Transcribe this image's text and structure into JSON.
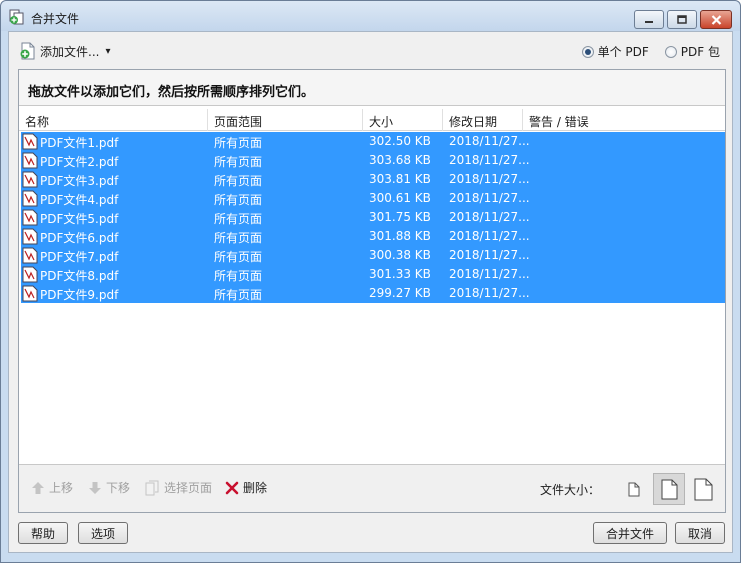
{
  "window": {
    "title": "合并文件"
  },
  "toolbar": {
    "add_files_label": "添加文件...",
    "dropdown_arrow": "▾"
  },
  "output_mode": {
    "options": [
      {
        "label": "单个 PDF",
        "selected": true
      },
      {
        "label": "PDF 包",
        "selected": false
      }
    ]
  },
  "instruction": "拖放文件以添加它们，然后按所需顺序排列它们。",
  "table": {
    "columns": [
      "名称",
      "页面范围",
      "大小",
      "修改日期",
      "警告 / 错误"
    ],
    "rows": [
      {
        "name": "PDF文件1.pdf",
        "range": "所有页面",
        "size": "302.50 KB",
        "date": "2018/11/27...",
        "warning": ""
      },
      {
        "name": "PDF文件2.pdf",
        "range": "所有页面",
        "size": "303.68 KB",
        "date": "2018/11/27...",
        "warning": ""
      },
      {
        "name": "PDF文件3.pdf",
        "range": "所有页面",
        "size": "303.81 KB",
        "date": "2018/11/27...",
        "warning": ""
      },
      {
        "name": "PDF文件4.pdf",
        "range": "所有页面",
        "size": "300.61 KB",
        "date": "2018/11/27...",
        "warning": ""
      },
      {
        "name": "PDF文件5.pdf",
        "range": "所有页面",
        "size": "301.75 KB",
        "date": "2018/11/27...",
        "warning": ""
      },
      {
        "name": "PDF文件6.pdf",
        "range": "所有页面",
        "size": "301.88 KB",
        "date": "2018/11/27...",
        "warning": ""
      },
      {
        "name": "PDF文件7.pdf",
        "range": "所有页面",
        "size": "300.38 KB",
        "date": "2018/11/27...",
        "warning": ""
      },
      {
        "name": "PDF文件8.pdf",
        "range": "所有页面",
        "size": "301.33 KB",
        "date": "2018/11/27...",
        "warning": ""
      },
      {
        "name": "PDF文件9.pdf",
        "range": "所有页面",
        "size": "299.27 KB",
        "date": "2018/11/27...",
        "warning": ""
      }
    ]
  },
  "list_tools": {
    "move_up": "上移",
    "move_down": "下移",
    "choose_pages": "选择页面",
    "delete": "删除"
  },
  "file_size": {
    "label": "文件大小："
  },
  "footer": {
    "help": "帮助",
    "options": "选项",
    "merge": "合并文件",
    "cancel": "取消"
  },
  "colors": {
    "selection": "#3399ff",
    "delete_icon": "#c8102e"
  }
}
